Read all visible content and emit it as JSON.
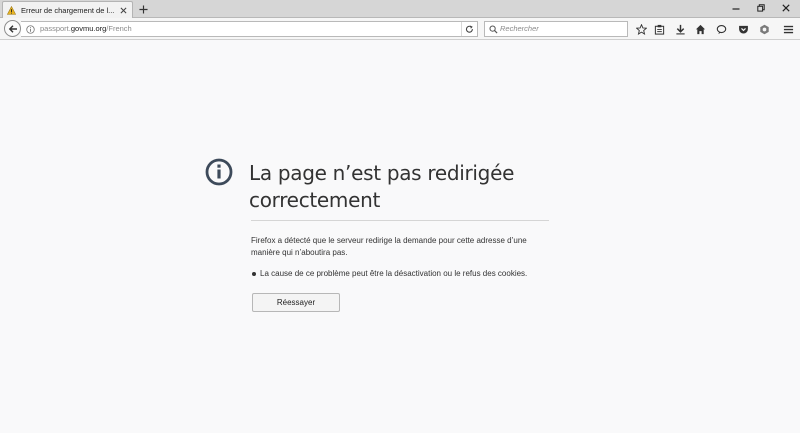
{
  "tab": {
    "title": "Erreur de chargement de l...",
    "icon": "warning-icon"
  },
  "navbar": {
    "url_prefix": "passport.",
    "url_host": "govmu.org",
    "url_path": "/French",
    "search_placeholder": "Rechercher"
  },
  "toolbar_icons": [
    "star-icon",
    "clipboard-icon",
    "download-icon",
    "home-icon",
    "chat-icon",
    "pocket-icon",
    "addon-icon",
    "menu-icon"
  ],
  "error": {
    "title": "La page n’est pas redirigée correctement",
    "description": "Firefox a détecté que le serveur redirige la demande pour cette adresse d’une manière qui n’aboutira pas.",
    "bullet": "La cause de ce problème peut être la désactivation ou le refus des cookies.",
    "retry_label": "Réessayer"
  },
  "colors": {
    "accent_warning": "#e8b422",
    "text": "#333333",
    "background": "#f9f9fa"
  }
}
